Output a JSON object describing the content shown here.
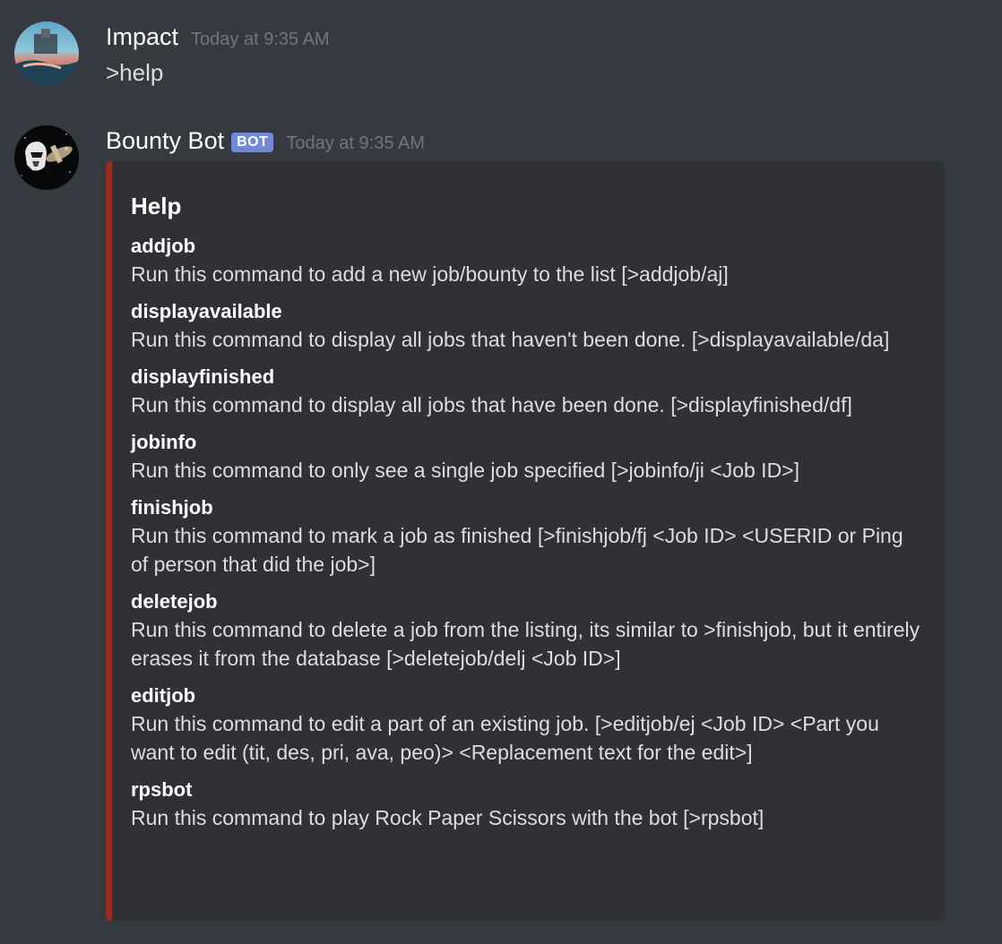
{
  "colors": {
    "background": "#36393f",
    "embed_background": "#2f3136",
    "embed_accent": "#992d22",
    "bot_tag": "#7289da",
    "timestamp": "#72767d"
  },
  "messages": [
    {
      "author": "Impact",
      "timestamp": "Today at 9:35 AM",
      "avatar_icon": "landscape-avatar-icon",
      "text": ">help"
    },
    {
      "author": "Bounty Bot",
      "bot_tag": "BOT",
      "timestamp": "Today at 9:35 AM",
      "avatar_icon": "starship-avatar-icon",
      "embed": {
        "title": "Help",
        "fields": [
          {
            "name": "addjob",
            "value": "Run this command to add a new job/bounty to the list [>addjob/aj]"
          },
          {
            "name": "displayavailable",
            "value": "Run this command to display all jobs that haven't been done. [>displayavailable/da]"
          },
          {
            "name": "displayfinished",
            "value": "Run this command to display all jobs that have been done. [>displayfinished/df]"
          },
          {
            "name": "jobinfo",
            "value": "Run this command to only see a single job specified [>jobinfo/ji <Job ID>]"
          },
          {
            "name": "finishjob",
            "value": "Run this command to mark a job as finished [>finishjob/fj <Job ID> <USERID or Ping of person that did the job>]"
          },
          {
            "name": "deletejob",
            "value": "Run this command to delete a job from the listing, its similar to >finishjob, but it entirely erases it from the database [>deletejob/delj <Job ID>]"
          },
          {
            "name": "editjob",
            "value": "Run this command to edit a part of an existing job. [>editjob/ej <Job ID> <Part you want to edit (tit, des, pri, ava, peo)> <Replacement text for the edit>]"
          },
          {
            "name": "rpsbot",
            "value": "Run this command to play Rock Paper Scissors with the bot [>rpsbot]"
          }
        ]
      }
    }
  ]
}
